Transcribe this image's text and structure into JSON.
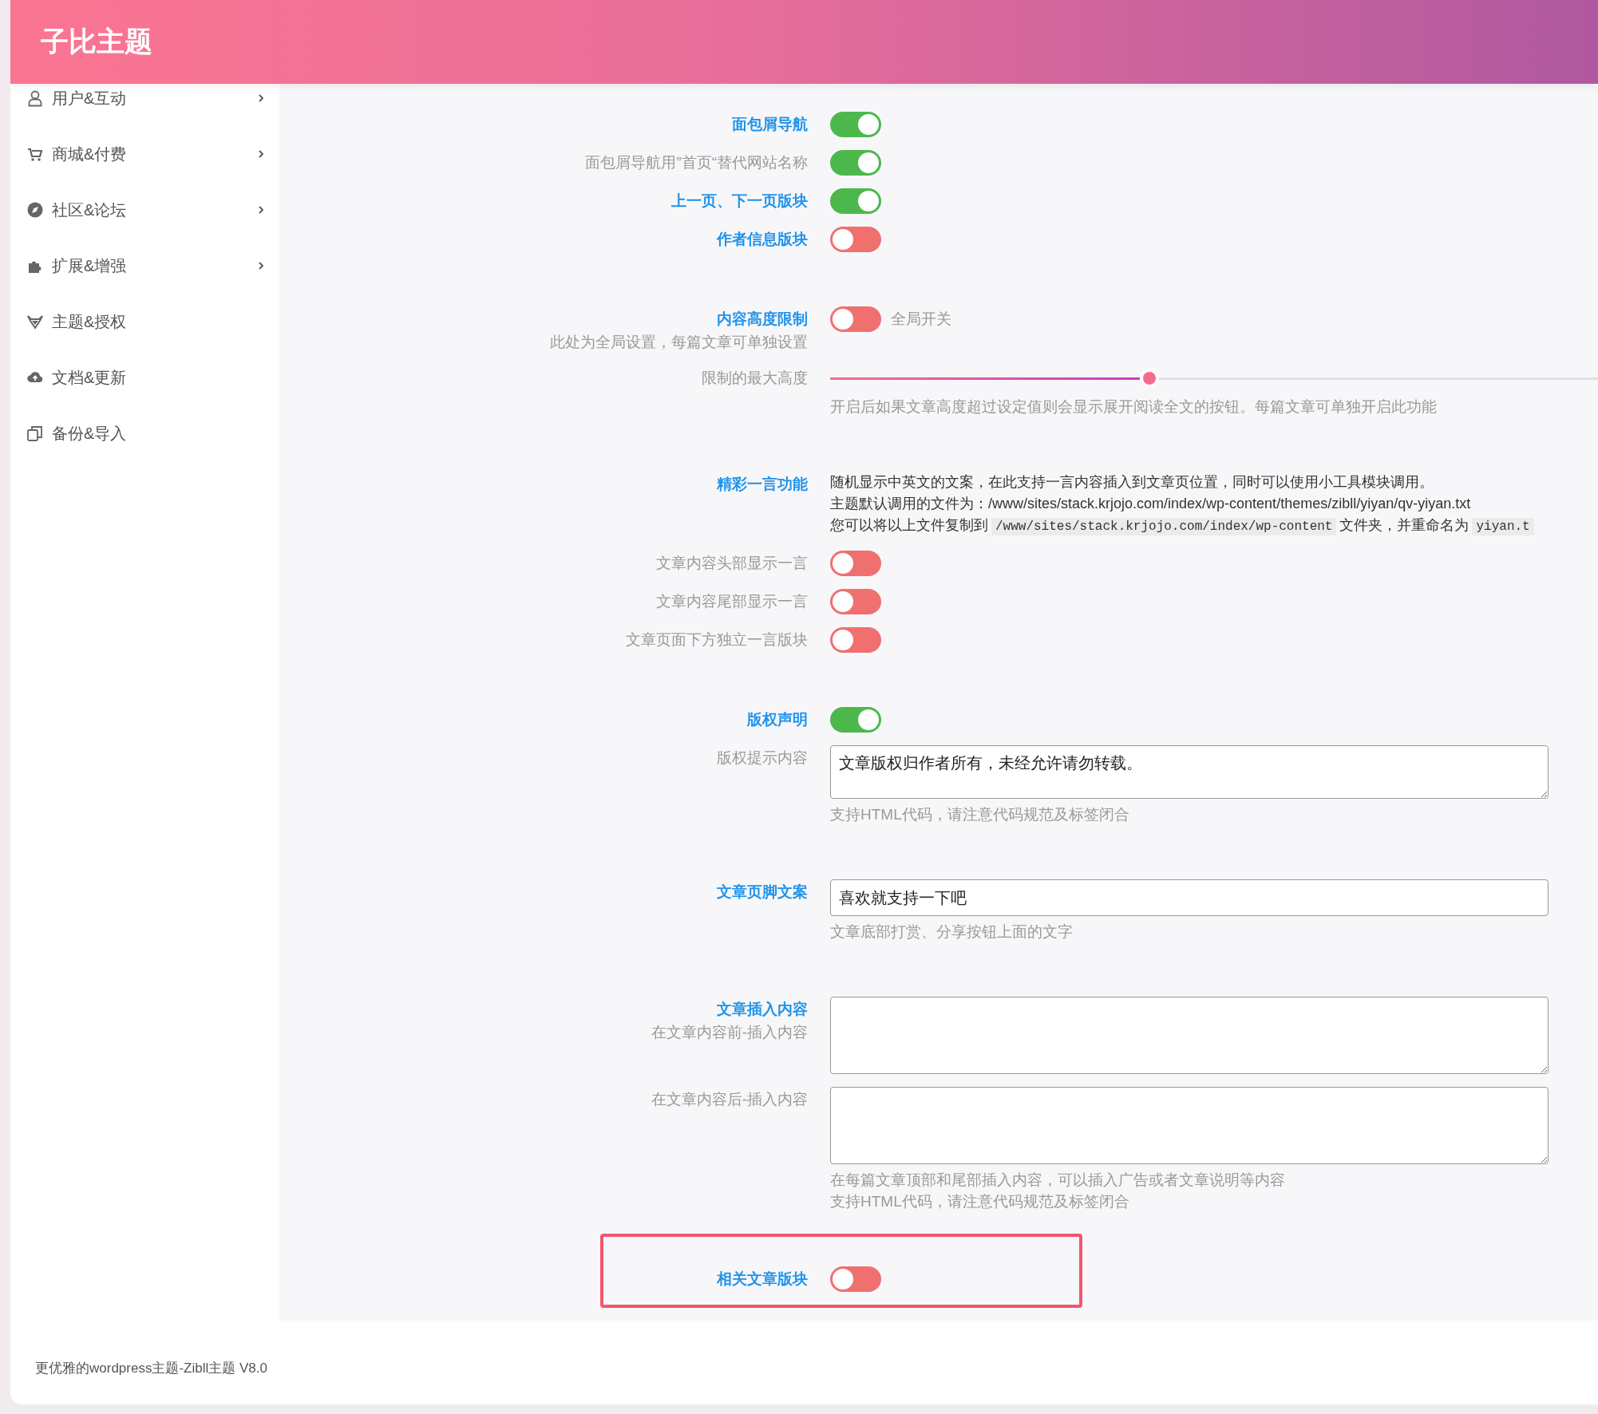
{
  "header": {
    "title": "子比主题"
  },
  "sidebar": {
    "items": [
      {
        "label": "用户&互动",
        "has_children": true
      },
      {
        "label": "商城&付费",
        "has_children": true
      },
      {
        "label": "社区&论坛",
        "has_children": true
      },
      {
        "label": "扩展&增强",
        "has_children": true
      },
      {
        "label": "主题&授权",
        "has_children": false
      },
      {
        "label": "文档&更新",
        "has_children": false
      },
      {
        "label": "备份&导入",
        "has_children": false
      }
    ]
  },
  "groups": [
    [
      {
        "kind": "toggle",
        "label": "面包屑导航",
        "heading": true,
        "on": true
      },
      {
        "kind": "toggle",
        "label": "面包屑导航用”首页“替代网站名称",
        "heading": false,
        "on": true
      },
      {
        "kind": "toggle",
        "label": "上一页、下一页版块",
        "heading": true,
        "on": true
      },
      {
        "kind": "toggle",
        "label": "作者信息版块",
        "heading": true,
        "on": false
      }
    ],
    [
      {
        "kind": "toggle",
        "label": "内容高度限制",
        "heading": true,
        "sublabel": "此处为全局设置，每篇文章可单独设置",
        "on": false,
        "note": "全局开关"
      },
      {
        "kind": "slider",
        "label": "限制的最大高度",
        "heading": false,
        "level": 0.4,
        "help": [
          "开启后如果文章高度超过设定值则会显示展开阅读全文的按钮。每篇文章可单独开启此功能"
        ]
      }
    ],
    [
      {
        "kind": "info",
        "label": "精彩一言功能",
        "heading": true,
        "lines": [
          [
            {
              "kind": "text",
              "text": "随机显示中英文的文案，在此支持一言内容插入到文章页位置，同时可以使用小工具模块调用。"
            }
          ],
          [
            {
              "kind": "text",
              "text": "主题默认调用的文件为：/www/sites/stack.krjojo.com/index/wp-content/themes/zibll/yiyan/qv-yiyan.txt"
            }
          ],
          [
            {
              "kind": "text",
              "text": "您可以将以上文件复制到"
            },
            {
              "kind": "code",
              "text": "/www/sites/stack.krjojo.com/index/wp-content"
            },
            {
              "kind": "text",
              "text": "文件夹，并重命名为"
            },
            {
              "kind": "code",
              "text": "yiyan.t"
            }
          ]
        ]
      },
      {
        "kind": "toggle",
        "label": "文章内容头部显示一言",
        "heading": false,
        "on": false
      },
      {
        "kind": "toggle",
        "label": "文章内容尾部显示一言",
        "heading": false,
        "on": false
      },
      {
        "kind": "toggle",
        "label": "文章页面下方独立一言版块",
        "heading": false,
        "on": false
      }
    ],
    [
      {
        "kind": "toggle",
        "label": "版权声明",
        "heading": true,
        "on": true
      },
      {
        "kind": "textarea",
        "label": "版权提示内容",
        "heading": false,
        "value": "文章版权归作者所有，未经允许请勿转载。",
        "help": [
          "支持HTML代码，请注意代码规范及标签闭合"
        ]
      }
    ],
    [
      {
        "kind": "input",
        "label": "文章页脚文案",
        "heading": true,
        "value": "喜欢就支持一下吧",
        "help": [
          "文章底部打赏、分享按钮上面的文字"
        ]
      }
    ],
    [
      {
        "kind": "textbox",
        "label": "文章插入内容",
        "heading": true,
        "sublabel": "在文章内容前-插入内容"
      },
      {
        "kind": "textbox",
        "label": "在文章内容后-插入内容",
        "heading": false,
        "help": [
          "在每篇文章顶部和尾部插入内容，可以插入广告或者文章说明等内容",
          "支持HTML代码，请注意代码规范及标签闭合"
        ]
      }
    ],
    [
      {
        "kind": "toggle",
        "label": "相关文章版块",
        "heading": true,
        "on": false,
        "highlighted": true
      }
    ]
  ],
  "footer": {
    "text": "更优雅的wordpress主题-Zibll主题 V8.0"
  }
}
